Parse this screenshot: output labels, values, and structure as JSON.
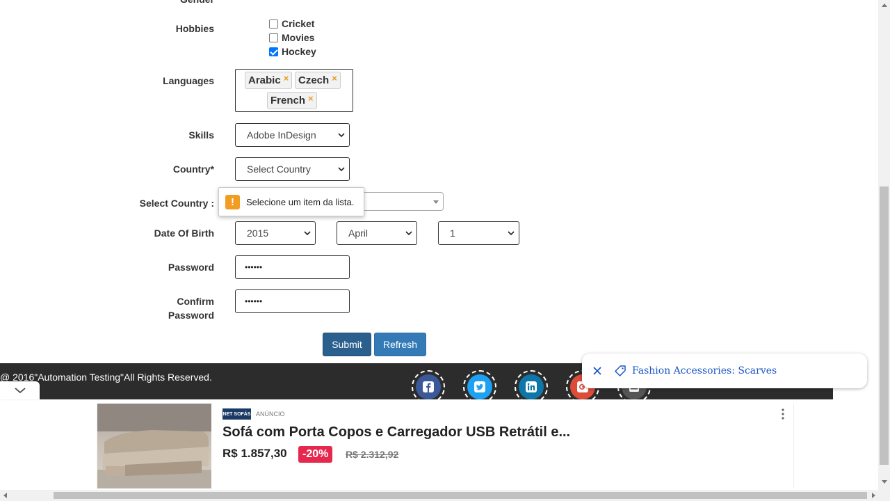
{
  "form": {
    "gender_label": "Gender",
    "hobbies_label": "Hobbies",
    "hobbies": [
      {
        "label": "Cricket",
        "checked": false
      },
      {
        "label": "Movies",
        "checked": false
      },
      {
        "label": "Hockey",
        "checked": true
      }
    ],
    "languages_label": "Languages",
    "languages": [
      "Arabic",
      "Czech",
      "French"
    ],
    "language_remove_glyph": "×",
    "skills_label": "Skills",
    "skills_value": "Adobe InDesign",
    "country_label": "Country*",
    "country_value": "Select Country",
    "select_country_label": "Select Country :",
    "dob_label": "Date Of Birth",
    "dob": {
      "year": "2015",
      "month": "April",
      "day": "1"
    },
    "password_label": "Password",
    "password_value": "••••••",
    "confirm_label_line1": "Confirm",
    "confirm_label_line2": "Password",
    "confirm_value": "••••••",
    "submit_label": "Submit",
    "refresh_label": "Refresh"
  },
  "validation_tooltip": {
    "icon": "!",
    "message": "Selecione um item da lista."
  },
  "footer": {
    "copyright": "@ 2016\"Automation Testing\"All Rights Reserved.",
    "social": [
      "facebook-icon",
      "twitter-icon",
      "linkedin-icon",
      "google-plus-icon",
      "rss-icon"
    ]
  },
  "toast": {
    "text": "Fashion Accessories: Scarves"
  },
  "ad": {
    "brand_line1": "NET",
    "brand_line2": "SOFÁS",
    "ad_label": "ANÚNCIO",
    "title": "Sofá com Porta Copos e Carregador USB Retrátil e...",
    "price": "R$ 1.857,30",
    "discount": "-20%",
    "old_price": "R$ 2.312,92"
  },
  "colors": {
    "primary_button": "#2a5f8e",
    "secondary_button": "#337ab7",
    "footer_bg": "#2c2c2c",
    "warning": "#f29c21",
    "discount": "#e6284e",
    "toast_link": "#1a56c7"
  }
}
